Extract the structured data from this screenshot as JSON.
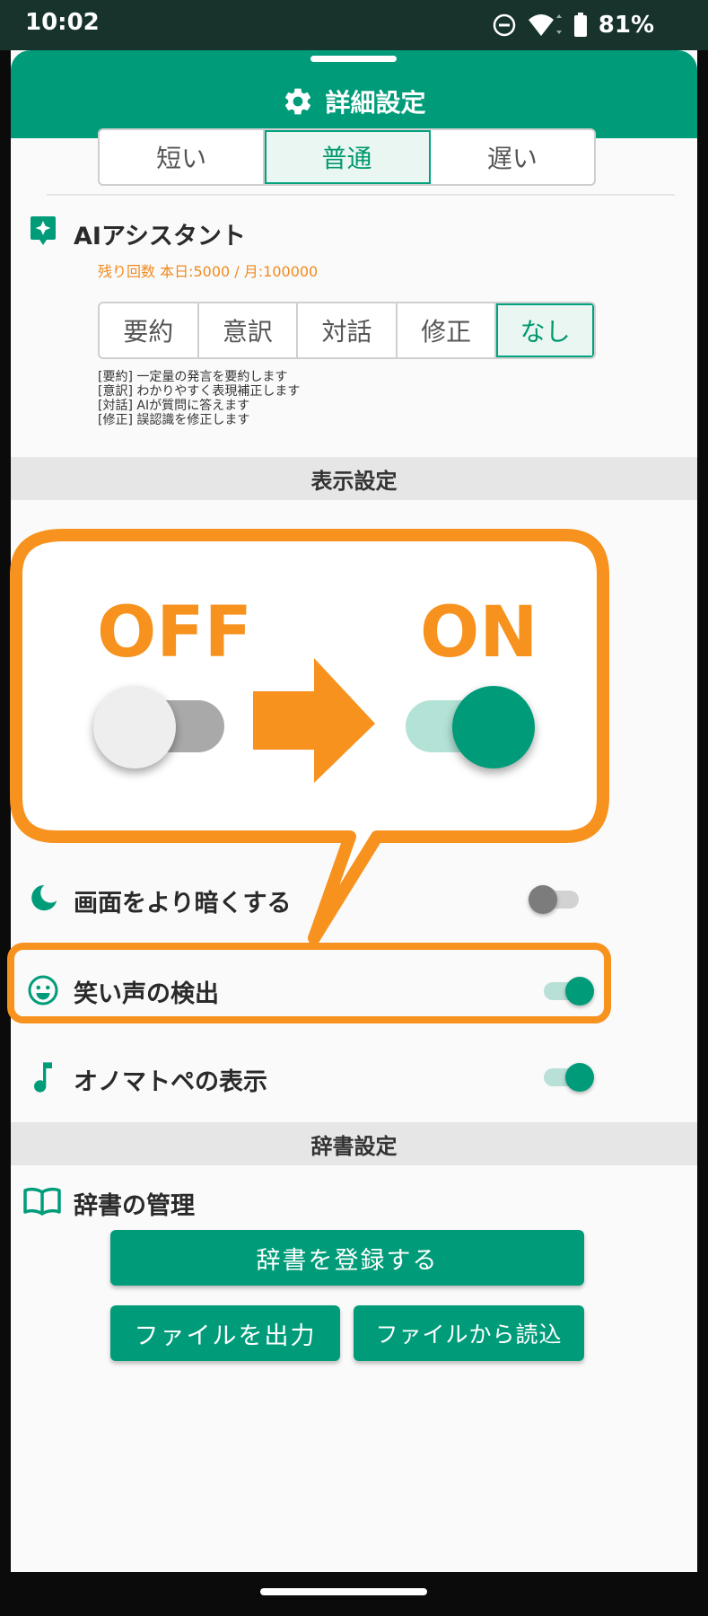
{
  "status_bar": {
    "time": "10:02",
    "battery": "81%",
    "icons": [
      "dnd-icon",
      "wifi-icon",
      "battery-icon"
    ]
  },
  "header": {
    "title": "詳細設定",
    "icon": "gear-icon"
  },
  "speed_selector": {
    "options": [
      "短い",
      "普通",
      "遅い"
    ],
    "selected": "普通"
  },
  "ai_assistant": {
    "label": "AIアシスタント",
    "icon": "ai-sparkle-icon",
    "remaining": "残り回数 本日:5000 / 月:100000",
    "modes": [
      "要約",
      "意訳",
      "対話",
      "修正",
      "なし"
    ],
    "selected": "なし",
    "descriptions": [
      "[要約] 一定量の発言を要約します",
      "[意訳] わかりやすく表現補正します",
      "[対話] AIが質問に答えます",
      "[修正] 誤認識を修正します"
    ]
  },
  "display_settings": {
    "section_title": "表示設定",
    "rows": [
      {
        "label": "画面をより暗くする",
        "icon": "moon-icon",
        "enabled": false
      },
      {
        "label": "笑い声の検出",
        "icon": "smile-icon",
        "enabled": true
      },
      {
        "label": "オノマトペの表示",
        "icon": "music-note-icon",
        "enabled": true
      }
    ]
  },
  "dictionary_settings": {
    "section_title": "辞書設定",
    "manage_label": "辞書の管理",
    "icon": "book-icon",
    "register_button": "辞書を登録する",
    "export_button": "ファイルを出力",
    "import_button": "ファイルから読込"
  },
  "callout": {
    "off_label": "OFF",
    "on_label": "ON",
    "color": "#f7921e"
  },
  "colors": {
    "brand": "#009c7a",
    "accent_orange": "#f7921e",
    "status_bar": "#17332c"
  }
}
